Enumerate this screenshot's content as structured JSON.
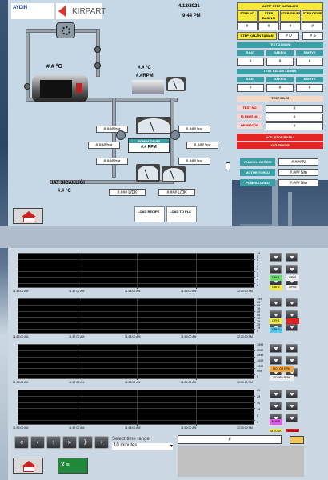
{
  "header": {
    "logo_left_text": "AYDIN",
    "logo_right_text": "KIRPART",
    "date": "4/12/2021",
    "time": "9:44 PM"
  },
  "process": {
    "tank_temp": "#.# °C",
    "motor_temp": "#.# °C",
    "motor_rpm": "#.#RPM",
    "pressure_labels": [
      "#.### bar",
      "#.### bar",
      "#.### bar",
      "#.### bar",
      "#.### bar",
      "#.### bar"
    ],
    "pump_label": "POMPA DEVRİ",
    "pump_rpm": "#.# RPM",
    "line_temp_label": "HAT SICAKLIĞI",
    "line_temp": "#.# °C",
    "flow_left": "#.### L/DK",
    "flow_right": "#.### L/DK",
    "load_recipe": "LOAD RECIPE",
    "load_plc": "LOAD TO PLC"
  },
  "step_data": {
    "title": "AKTİF STEP DATALARI",
    "headers": [
      "STEP NO",
      "STEP BASINCI",
      "STEP DEVRİ",
      "STEP DEVRİ"
    ],
    "values": [
      "#",
      "#",
      "#",
      "#"
    ],
    "remaining_label": "STEP KALAN ZAMAN",
    "remaining_d": "# D",
    "remaining_s": "# S"
  },
  "test_time": {
    "title": "TEST ZAMANI",
    "cols": [
      "SAAT",
      "DAKİKA",
      "SANİYE"
    ],
    "values": [
      "#",
      "#",
      "#"
    ]
  },
  "test_remaining": {
    "title": "TEST KALAN ZAMAN",
    "cols": [
      "SAAT",
      "DAKİKA",
      "SANİYE"
    ],
    "values": [
      "#",
      "#",
      "#"
    ]
  },
  "test_info": {
    "title": "TEST BİLGİ",
    "rows": [
      {
        "label": "TEST NO",
        "value": "#"
      },
      {
        "label": "İŞ EMRİ NO",
        "value": "#"
      },
      {
        "label": "OPERATÖR",
        "value": "#"
      }
    ],
    "alarm1": "ACİL STOP BASILI",
    "alarm2": "YAĞ SEVİYE"
  },
  "force": {
    "rows": [
      {
        "label": "YANKIKLI DEĞERİ",
        "value": "#.### N"
      },
      {
        "label": "MOTOR TORKU",
        "value": "#.### Nm"
      },
      {
        "label": "POMPA TORKU",
        "value": "#.### Nm"
      }
    ]
  },
  "trend": {
    "charts": [
      {
        "yticks": [
          "10",
          "9",
          "8",
          "7",
          "6",
          "5",
          "4",
          "3",
          "2",
          "1",
          "0"
        ],
        "xticks": [
          "11:56:00 AM",
          "11:57:00 AM",
          "11:58:00 AM",
          "11:59:00 AM",
          "12:00:00 PM"
        ]
      },
      {
        "yticks": [
          "100",
          "90",
          "80",
          "70",
          "60",
          "50",
          "40",
          "30",
          "20",
          "10",
          "0"
        ],
        "xticks": [
          "11:56:00 AM",
          "11:57:00 AM",
          "11:58:00 AM",
          "11:59:00 AM",
          "12:00:00 PM"
        ]
      },
      {
        "yticks": [
          "3000",
          "2500",
          "2000",
          "1500",
          "1000",
          "500",
          "0"
        ],
        "xticks": [
          "11:56:00 AM",
          "11:57:00 AM",
          "11:58:00 AM",
          "11:59:00 AM",
          "12:00:00 PM"
        ]
      },
      {
        "yticks": [
          "25",
          "20",
          "15",
          "10",
          "5",
          "0"
        ],
        "xticks": [
          "11:56:00 AM",
          "11:57:00 AM",
          "11:58:00 AM",
          "11:59:00 AM",
          "12:00:00 PM"
        ]
      }
    ],
    "legend": [
      {
        "t": "DBH1",
        "c": "#6ad96a"
      },
      {
        "t": "DPH1",
        "c": "#eeeeee"
      },
      {
        "t": "DBH2",
        "c": "#f0ea4a"
      },
      {
        "t": "DPH2",
        "c": "#eeeeee"
      },
      {
        "t": "DPH1",
        "c": "#f0ea4a"
      },
      {
        "t": "",
        "c": "#e02020"
      },
      {
        "t": "DPH2",
        "c": "#56c4e8"
      },
      {
        "t": "MOTOR RPM",
        "c": "#f0a840"
      },
      {
        "t": "POMPA RPM",
        "c": "#eeeeee"
      },
      {
        "t": "M.HIZI",
        "c": "#e55ae5"
      },
      {
        "t": "M.TORK",
        "c": "#f0ea4a"
      },
      {
        "t": "P.TORK",
        "c": "#e02020"
      }
    ],
    "time_range_label": "Select time range:",
    "time_range_value": "10 minutes",
    "value_field": "#"
  },
  "colors": {
    "accent_yellow": "#f7e83a",
    "accent_teal": "#3aa0a6",
    "alarm_red": "#e32525"
  }
}
